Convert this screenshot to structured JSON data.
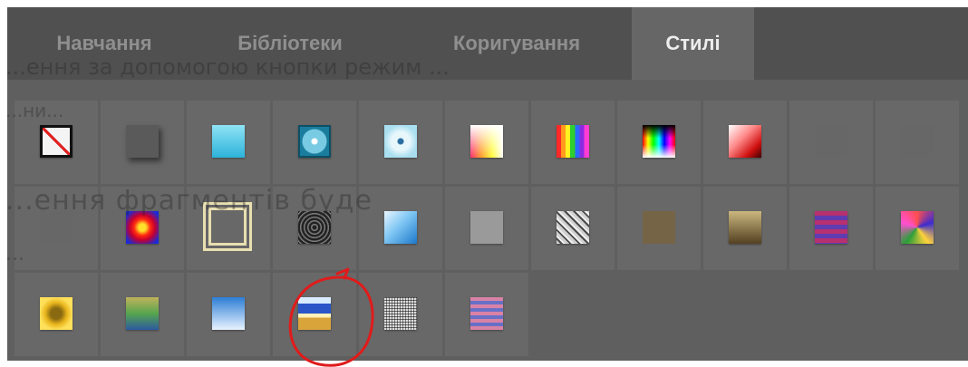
{
  "tabs": [
    {
      "label": "Навчання",
      "active": false
    },
    {
      "label": "Бібліотеки",
      "active": false
    },
    {
      "label": "Коригування",
      "active": false
    },
    {
      "label": "Стилі",
      "active": true
    }
  ],
  "background_text": [
    "...ення за допомогою кнопки    режим ...",
    "...ни...",
    "...ення фрагментів буде",
    "..."
  ],
  "styles": [
    {
      "name": "no-style",
      "icon": "no-style-icon"
    },
    {
      "name": "gray-drop-shadow",
      "icon": "drop-shadow-icon"
    },
    {
      "name": "cyan-gradient",
      "icon": "gradient-icon"
    },
    {
      "name": "blue-bevel-frame",
      "icon": "bevel-frame-icon"
    },
    {
      "name": "light-blue-inner-glow",
      "icon": "inner-glow-icon"
    },
    {
      "name": "spectrum-fade-vertical",
      "icon": "spectrum-icon"
    },
    {
      "name": "rainbow-stripes",
      "icon": "rainbow-icon"
    },
    {
      "name": "color-picker-gradient",
      "icon": "color-picker-icon"
    },
    {
      "name": "red-gradient",
      "icon": "red-gradient-icon"
    },
    {
      "name": "empty-gray",
      "icon": "blank-style-icon"
    },
    {
      "name": "empty-gray-2",
      "icon": "blank-style-icon"
    },
    {
      "name": "empty-gray-3",
      "icon": "blank-style-icon"
    },
    {
      "name": "radial-fire",
      "icon": "radial-gradient-icon"
    },
    {
      "name": "cream-double-border",
      "icon": "double-border-icon"
    },
    {
      "name": "concentric-rings",
      "icon": "rings-icon"
    },
    {
      "name": "blue-glass",
      "icon": "glass-icon"
    },
    {
      "name": "flat-gray",
      "icon": "flat-gray-icon"
    },
    {
      "name": "grunge-texture",
      "icon": "texture-icon"
    },
    {
      "name": "faded-tan",
      "icon": "tan-icon"
    },
    {
      "name": "bronze-gradient",
      "icon": "bronze-icon"
    },
    {
      "name": "purple-red-stripes",
      "icon": "stripes-icon"
    },
    {
      "name": "psychedelic-pattern",
      "icon": "pattern-icon"
    },
    {
      "name": "gold-yellow-glow",
      "icon": "gold-glow-icon"
    },
    {
      "name": "green-blue-gradient",
      "icon": "green-blue-icon"
    },
    {
      "name": "sky-gradient",
      "icon": "sky-icon"
    },
    {
      "name": "beach-horizon",
      "icon": "horizon-icon"
    },
    {
      "name": "white-noise",
      "icon": "noise-icon"
    },
    {
      "name": "pink-blue-stripes",
      "icon": "pink-stripes-icon"
    }
  ],
  "annotation": {
    "color": "#e01b1b",
    "circled_style": "beach-horizon"
  }
}
